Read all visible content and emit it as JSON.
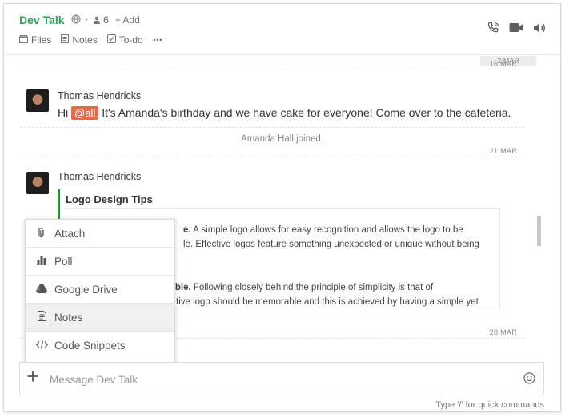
{
  "header": {
    "title": "Dev Talk",
    "member_count": "6",
    "add_label": "+ Add",
    "tabs": [
      {
        "label": "Files",
        "icon": "files-icon"
      },
      {
        "label": "Notes",
        "icon": "notes-icon"
      },
      {
        "label": "To-do",
        "icon": "todo-icon"
      }
    ],
    "more_label": "⋯"
  },
  "messages": {
    "date_badge_top": "2 MAR",
    "date_1": "16 MAR",
    "msg1": {
      "author": "Thomas Hendricks",
      "prefix": "Hi",
      "mention": "@all",
      "text": "It's Amanda's birthday and we have cake for everyone! Come over to the cafeteria."
    },
    "system_join": "Amanda Hall joined.",
    "date_2": "21 MAR",
    "msg2": {
      "author": "Thomas Hendricks",
      "quote_title": "Logo Design Tips",
      "line1_bold": "e.",
      "line1": " A simple logo allows for easy recognition and allows the logo to be",
      "line2": "le. Effective logos feature something unexpected or unique without being",
      "line3_bold": "orable.",
      "line3": " Following closely behind the principle of simplicity is that of",
      "line4": "tive logo should be memorable and this is achieved by having a simple yet"
    },
    "date_3": "28 MAR"
  },
  "popup": {
    "items": [
      {
        "label": "Attach",
        "icon": "paperclip-icon"
      },
      {
        "label": "Poll",
        "icon": "poll-icon"
      },
      {
        "label": "Google Drive",
        "icon": "google-drive-icon"
      },
      {
        "label": "Notes",
        "icon": "notes-icon"
      },
      {
        "label": "Code Snippets",
        "icon": "code-icon"
      }
    ],
    "active_index": 3
  },
  "composer": {
    "placeholder": "Message Dev Talk",
    "hint": "Type '/' for quick commands"
  },
  "colors": {
    "title": "#2ea25a",
    "mention_bg": "#e8684a",
    "quote_bar": "#2e8b3e"
  }
}
